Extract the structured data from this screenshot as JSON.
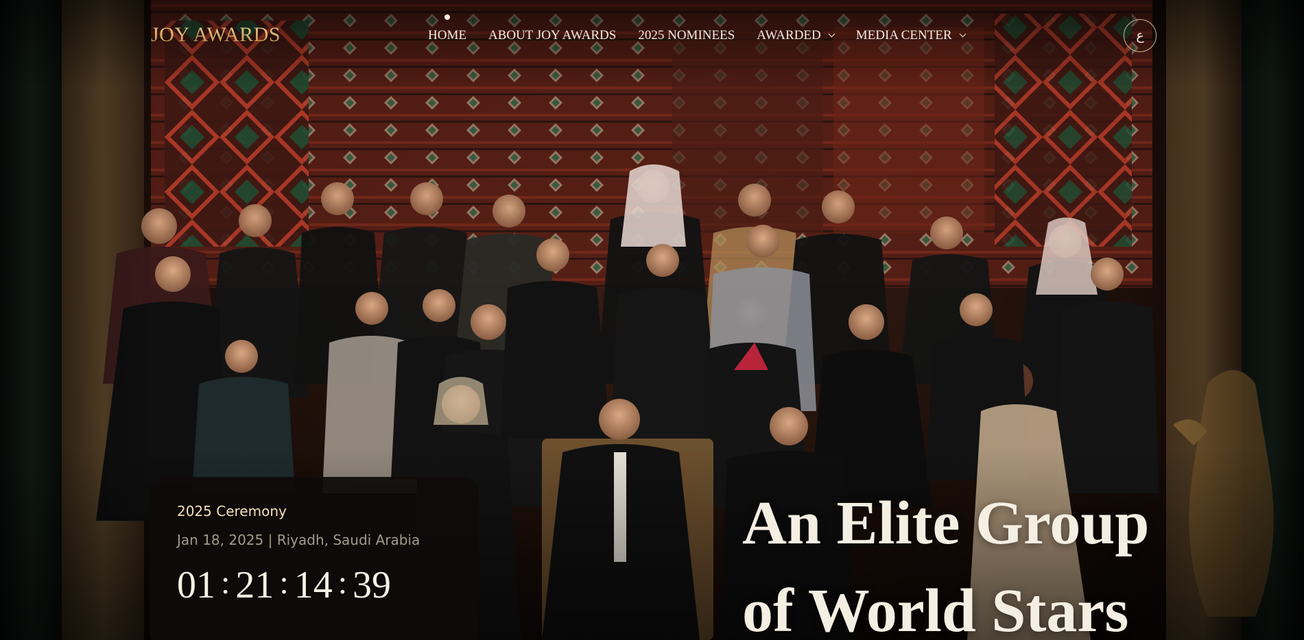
{
  "header": {
    "logo_text": "JOY AWARDS",
    "nav": [
      {
        "label": "HOME",
        "active": true,
        "dropdown": false
      },
      {
        "label": "ABOUT JOY AWARDS",
        "active": false,
        "dropdown": false
      },
      {
        "label": "2025 NOMINEES",
        "active": false,
        "dropdown": false
      },
      {
        "label": "AWARDED",
        "active": false,
        "dropdown": true
      },
      {
        "label": "MEDIA CENTER",
        "active": false,
        "dropdown": true
      }
    ],
    "language_toggle": "ع"
  },
  "event": {
    "title": "2025 Ceremony",
    "meta": "Jan 18, 2025 | Riyadh, Saudi Arabia",
    "countdown": {
      "days": "01",
      "hours": "21",
      "minutes": "14",
      "seconds": "39",
      "separator": ":"
    }
  },
  "hero": {
    "headline_line1": "An Elite Group",
    "headline_line2": "of World Stars"
  },
  "colors": {
    "logo_gold": "#d9b978",
    "nav_text": "#f4eee4",
    "card_bg": "#0e0b0a",
    "card_title": "#f7dfb9",
    "card_meta": "#a29a8c"
  },
  "icons": {
    "chevron": "chevron-down-icon",
    "active_indicator": "dot-indicator"
  }
}
